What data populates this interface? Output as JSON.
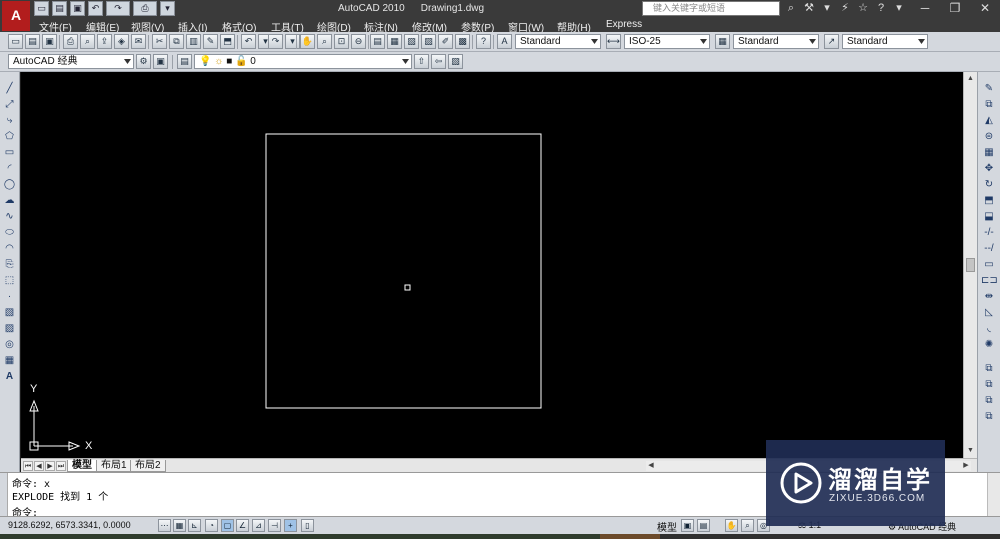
{
  "window": {
    "app_name": "AutoCAD 2010",
    "document": "Drawing1.dwg",
    "search_placeholder": "键入关键字或短语",
    "logo_text": "A",
    "minimize": "─",
    "restore": "❐",
    "close": "✕"
  },
  "menu": {
    "items": [
      "文件(F)",
      "编辑(E)",
      "视图(V)",
      "插入(I)",
      "格式(O)",
      "工具(T)",
      "绘图(D)",
      "标注(N)",
      "修改(M)",
      "参数(P)",
      "窗口(W)",
      "帮助(H)",
      "Express"
    ]
  },
  "toolbar": {
    "text_style": "Standard",
    "dim_style": "ISO-25",
    "table_style": "Standard",
    "multileader_style": "Standard",
    "workspace": "AutoCAD 经典",
    "layer": "0"
  },
  "canvas": {
    "ucs_y": "Y",
    "ucs_x": "X"
  },
  "layout_tabs": [
    "模型",
    "布局1",
    "布局2"
  ],
  "command": {
    "history_1": "命令: x",
    "history_2": "EXPLODE 找到 1 个",
    "prompt": "命令:"
  },
  "status": {
    "coordinates": "9128.6292, 6573.3341, 0.0000",
    "model_label": "模型",
    "annotation_scale": "1:1",
    "workspace": "AutoCAD 经典"
  },
  "watermark": {
    "title": "溜溜自学",
    "url": "ZIXUE.3D66.COM"
  },
  "colors": {
    "canvas_bg": "#000000",
    "drawing_line": "#ffffff",
    "chrome_dark": "#3a3a3a",
    "toolbar_bg": "#d4d8de",
    "logo_red": "#b21d1d",
    "watermark_bg": "#202c54"
  }
}
